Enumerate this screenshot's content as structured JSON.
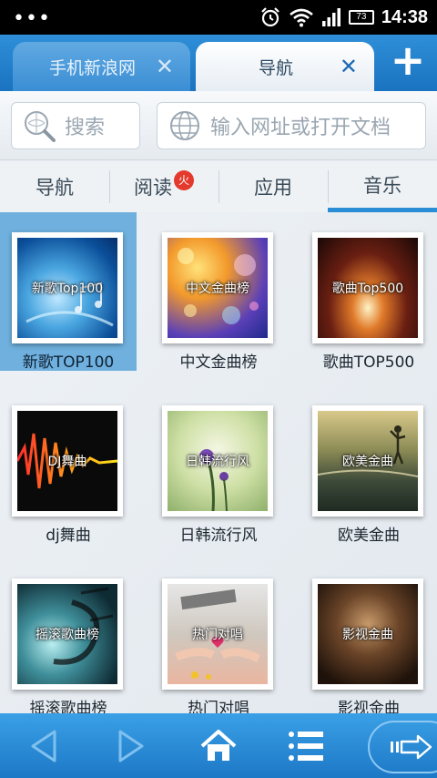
{
  "status_bar": {
    "menu_dots": "•••",
    "battery_level": "73",
    "time": "14:38"
  },
  "tabs": [
    {
      "label": "手机新浪网",
      "close": "✕"
    },
    {
      "label": "导航",
      "close": "✕"
    }
  ],
  "new_tab": "+",
  "search": {
    "placeholder": "搜索"
  },
  "url_bar": {
    "placeholder": "输入网址或打开文档"
  },
  "categories": [
    {
      "label": "导航"
    },
    {
      "label": "阅读",
      "badge": "火"
    },
    {
      "label": "应用"
    },
    {
      "label": "音乐"
    }
  ],
  "items": [
    {
      "title": "新歌Top100",
      "caption": "新歌TOP100"
    },
    {
      "title": "中文金曲榜",
      "caption": "中文金曲榜"
    },
    {
      "title": "歌曲Top500",
      "caption": "歌曲TOP500"
    },
    {
      "title": "DJ舞曲",
      "caption": "dj舞曲"
    },
    {
      "title": "日韩流行风",
      "caption": "日韩流行风"
    },
    {
      "title": "欧美金曲",
      "caption": "欧美金曲"
    },
    {
      "title": "摇滚歌曲榜",
      "caption": "摇滚歌曲榜"
    },
    {
      "title": "热门对唱",
      "caption": "热门对唱"
    },
    {
      "title": "影视金曲",
      "caption": "影视金曲"
    }
  ],
  "colors": {
    "accent": "#2a8ed6",
    "selected_cell": "#6fb0de",
    "toolbar": "#1d78c6"
  },
  "toolbar_icons": [
    "back-icon",
    "forward-icon",
    "home-icon",
    "menu-icon",
    "exit-icon"
  ]
}
